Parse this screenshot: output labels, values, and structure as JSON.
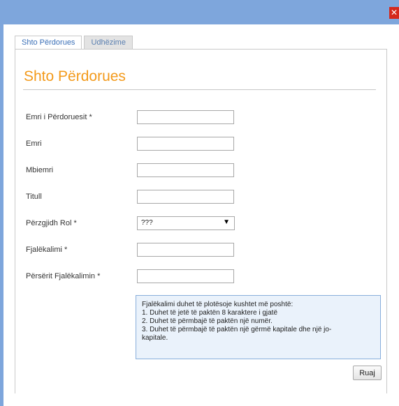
{
  "dialog": {
    "close_glyph": "✕"
  },
  "tabs": [
    {
      "label": "Shto Përdorues",
      "active": true
    },
    {
      "label": "Udhëzime",
      "active": false
    }
  ],
  "form": {
    "title": "Shto Përdorues",
    "username_label": "Emri i Përdoruesit *",
    "username_value": "",
    "firstname_label": "Emri",
    "firstname_value": "",
    "lastname_label": "Mbiemri",
    "lastname_value": "",
    "title_label": "Titull",
    "title_value": "",
    "role_label": "Përzgjidh Rol *",
    "role_value": "???",
    "password_label": "Fjalëkalimi *",
    "password_value": "",
    "confirm_label": "Përsërit Fjalëkalimin *",
    "confirm_value": ""
  },
  "password_rules": [
    "Fjalëkalimi duhet të plotësoje kushtet më poshtë:",
    "1. Duhet të jetë të paktën 8 karaktere i gjatë",
    "2. Duhet të përmbajë të paktën një numër.",
    "3. Duhet të përmbajë të paktën një gërmë kapitale dhe një jo-",
    "kapitale."
  ],
  "actions": {
    "save_label": "Ruaj"
  },
  "colors": {
    "accent": "#f39a1b",
    "frame": "#7ea6dc",
    "close": "#d5281c",
    "info_bg": "#eaf2fb"
  }
}
